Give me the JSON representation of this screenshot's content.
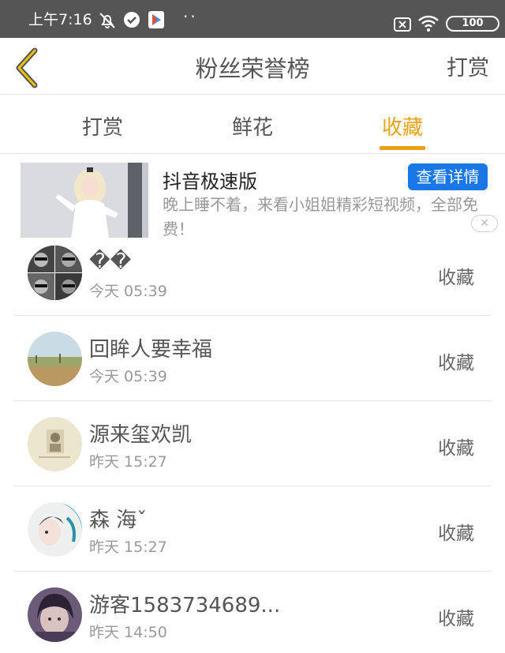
{
  "status_bar": {
    "time": "上午7:16",
    "dots": "··",
    "battery": "100",
    "icons": [
      "mute-bell-icon",
      "check-circle-icon",
      "play-store-icon",
      "sim-off-icon",
      "wifi-icon",
      "battery-icon"
    ]
  },
  "header": {
    "title": "粉丝荣誉榜",
    "right_action": "打赏",
    "back_icon": "chevron-left-icon",
    "accent_color": "#e8a312"
  },
  "tabs": [
    {
      "label": "打赏",
      "active": false
    },
    {
      "label": "鲜花",
      "active": false
    },
    {
      "label": "收藏",
      "active": true
    }
  ],
  "ad": {
    "title": "抖音极速版",
    "cta": "查看详情",
    "description": "晚上睡不着，来看小姐姐精彩短视频，全部免费！",
    "cta_color": "#1a78e6"
  },
  "list": [
    {
      "name": "��",
      "time": "今天 05:39",
      "action": "收藏"
    },
    {
      "name": "回眸人要幸福",
      "time": "今天 05:39",
      "action": "收藏"
    },
    {
      "name": "源来玺欢凯",
      "time": "昨天 15:27",
      "action": "收藏"
    },
    {
      "name": "森 海ˇ",
      "time": "昨天 15:27",
      "action": "收藏"
    },
    {
      "name": "游客1583734689...",
      "time": "昨天 14:50",
      "action": "收藏"
    }
  ]
}
